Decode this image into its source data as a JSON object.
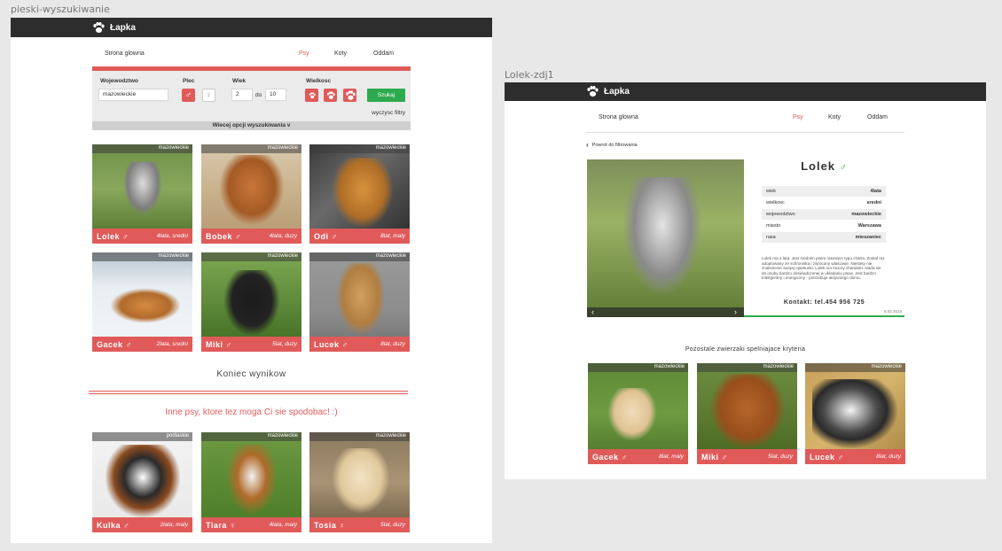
{
  "brand": "Łapka",
  "colors": {
    "accent": "#e05a5a",
    "green": "#2eaa4e",
    "dark": "#2d2d2d"
  },
  "left": {
    "artboard_label": "pieski-wyszukiwanie",
    "nav": {
      "home": "Strona glowna",
      "dogs": "Psy",
      "cats": "Koty",
      "give": "Oddam"
    },
    "filters": {
      "voivodeship_label": "Wojewodztwo",
      "voivodeship_value": "mazowieckie",
      "sex_label": "Plec",
      "age_label": "Wiek",
      "age_from": "2",
      "age_to_label": "do",
      "age_to": "10",
      "size_label": "Wielkosc",
      "search_button": "Szukaj",
      "clear": "wyczysc filtry",
      "more": "Wiecej opcji wyszukiwania v"
    },
    "results": [
      {
        "name": "Lolek",
        "sex": "♂",
        "meta": "4lata, sredni",
        "region": "mazowieckie"
      },
      {
        "name": "Bobek",
        "sex": "♂",
        "meta": "4lata, duzy",
        "region": "mazowieckie"
      },
      {
        "name": "Odi",
        "sex": "♂",
        "meta": "8lat, maly",
        "region": "mazowieckie"
      },
      {
        "name": "Gacek",
        "sex": "♂",
        "meta": "2lata, sredni",
        "region": "mazowieckie"
      },
      {
        "name": "Miki",
        "sex": "♂",
        "meta": "5lat, duzy",
        "region": "mazowieckie"
      },
      {
        "name": "Lucek",
        "sex": "♂",
        "meta": "8lat, duzy",
        "region": "mazowieckie"
      }
    ],
    "end_of_results": "Koniec wynikow",
    "others_title": "Inne psy, ktore tez moga Ci sie spodobac! :)",
    "others": [
      {
        "name": "Kulka",
        "sex": "♂",
        "meta": "2lata, maly",
        "region": "podlaskie"
      },
      {
        "name": "Tiara",
        "sex": "♀",
        "meta": "4lata, maly",
        "region": "mazowieckie"
      },
      {
        "name": "Tosia",
        "sex": "♀",
        "meta": "5lat, duzy",
        "region": "mazowieckie"
      }
    ]
  },
  "right": {
    "artboard_label": "Lolek-zdj1",
    "nav": {
      "home": "Strona glowna",
      "dogs": "Psy",
      "cats": "Koty",
      "give": "Oddam"
    },
    "back": "Powrot do filtrowania",
    "dog_name": "Lolek",
    "dog_sex": "♂",
    "info": [
      {
        "k": "wiek",
        "v": "4lata"
      },
      {
        "k": "wielkosc",
        "v": "sredni"
      },
      {
        "k": "wojewodztwo",
        "v": "mazowieckie"
      },
      {
        "k": "miasto",
        "v": "Warszawa"
      },
      {
        "k": "rasa",
        "v": "mieszaniec"
      }
    ],
    "description": "Lolek ma 4 lata. Jest srednim psem rasowym typu charta. Zostal raz adoptowany ze schroniska i zwrocony wlasciwie. Niestety nie znalezienie swojej opiekunki. Lolek ma mocny charakter. Nada sie do osoby bardzo doswiadczonej w ukladaniu psow. Jest bardzo inteligentny i energiczny - potrzebuje aktywnego domu.",
    "contact": "Kontakt: tel.454 956 725",
    "date": "9.02.2018",
    "similar_title": "Pozostale zwierzaki spelniajace kryteria",
    "similar": [
      {
        "name": "Gacek",
        "sex": "♂",
        "meta": "8lat, maly",
        "region": "mazowieckie"
      },
      {
        "name": "Miki",
        "sex": "♂",
        "meta": "5lat, duzy",
        "region": "mazowieckie"
      },
      {
        "name": "Lucek",
        "sex": "♂",
        "meta": "8lat, duzy",
        "region": "mazowieckie"
      }
    ]
  }
}
